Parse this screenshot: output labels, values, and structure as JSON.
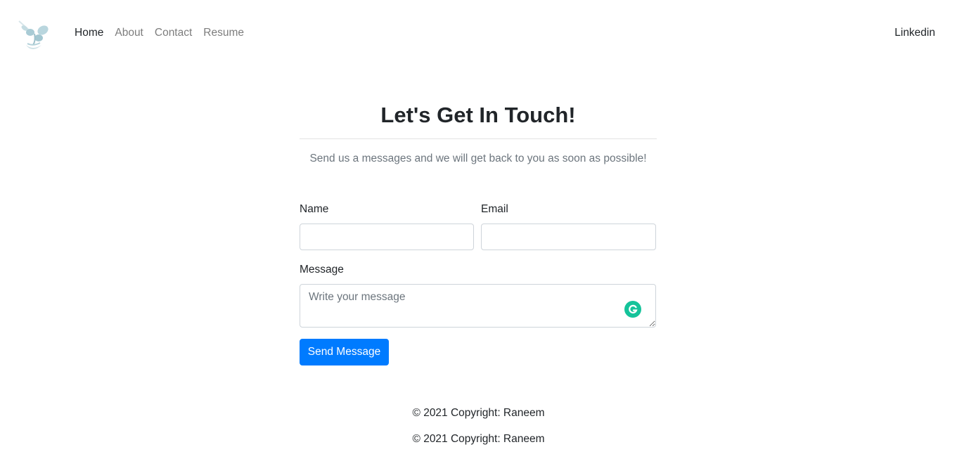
{
  "nav": {
    "logo_icon": "plant-logo-icon",
    "links": [
      "Home",
      "About",
      "Contact",
      "Resume"
    ],
    "active": "Home",
    "right_link": "Linkedin"
  },
  "contact": {
    "title": "Let's Get In Touch!",
    "subtitle": "Send us a messages and we will get back to you as soon as possible!",
    "name_label": "Name",
    "name_value": "",
    "email_label": "Email",
    "email_value": "",
    "message_label": "Message",
    "message_placeholder": "Write your message",
    "grammarly_icon": "grammarly-icon",
    "submit_label": "Send Message"
  },
  "footer": {
    "copyright_1": "© 2021 Copyright: Raneem",
    "copyright_2": "© 2021 Copyright: Raneem"
  },
  "colors": {
    "primary": "#007bff",
    "text": "#212529",
    "muted": "#6c757d",
    "grammarly": "#15c39a"
  }
}
